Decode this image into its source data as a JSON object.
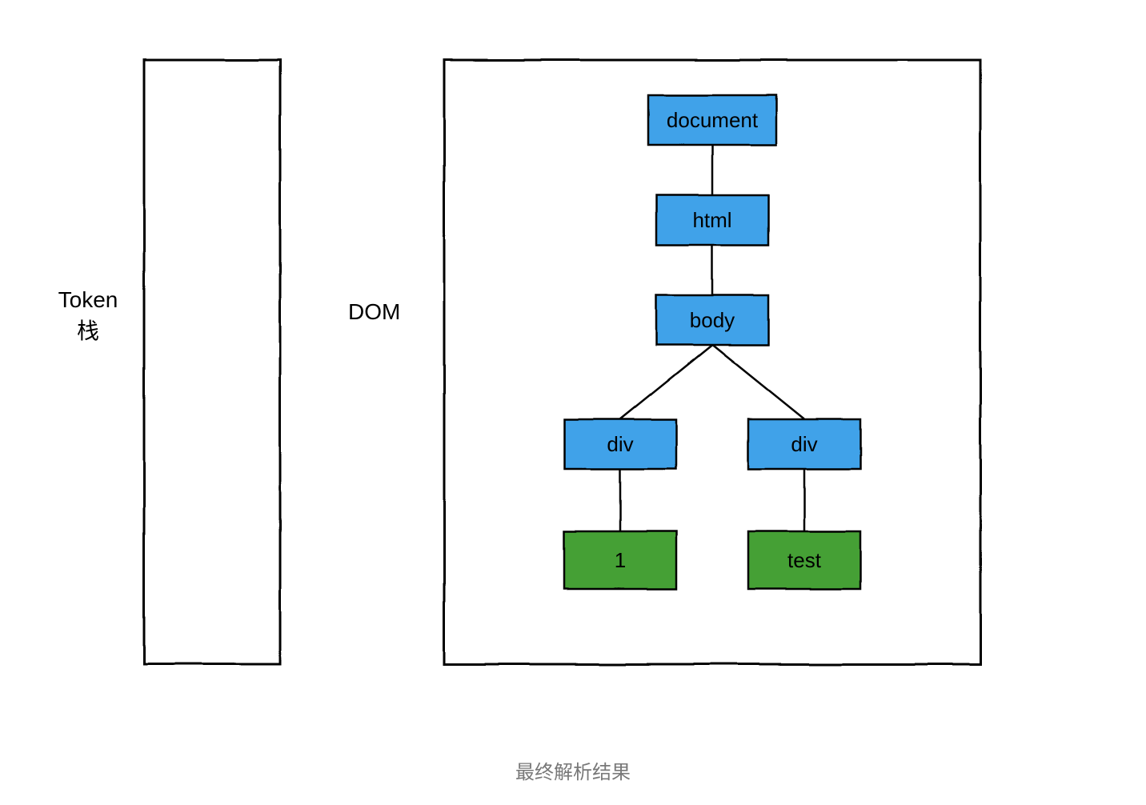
{
  "token_stack": {
    "label_line1": "Token",
    "label_line2": "栈"
  },
  "dom": {
    "label": "DOM",
    "nodes": {
      "document": {
        "label": "document",
        "color": "element"
      },
      "html": {
        "label": "html",
        "color": "element"
      },
      "body": {
        "label": "body",
        "color": "element"
      },
      "div_left": {
        "label": "div",
        "color": "element"
      },
      "div_right": {
        "label": "div",
        "color": "element"
      },
      "leaf_1": {
        "label": "1",
        "color": "text"
      },
      "leaf_test": {
        "label": "test",
        "color": "text"
      }
    },
    "edges": [
      [
        "document",
        "html"
      ],
      [
        "html",
        "body"
      ],
      [
        "body",
        "div_left"
      ],
      [
        "body",
        "div_right"
      ],
      [
        "div_left",
        "leaf_1"
      ],
      [
        "div_right",
        "leaf_test"
      ]
    ]
  },
  "caption": "最终解析结果",
  "colors": {
    "element_fill": "#3fa2e9",
    "text_fill": "#44a035",
    "stroke": "#000000"
  }
}
